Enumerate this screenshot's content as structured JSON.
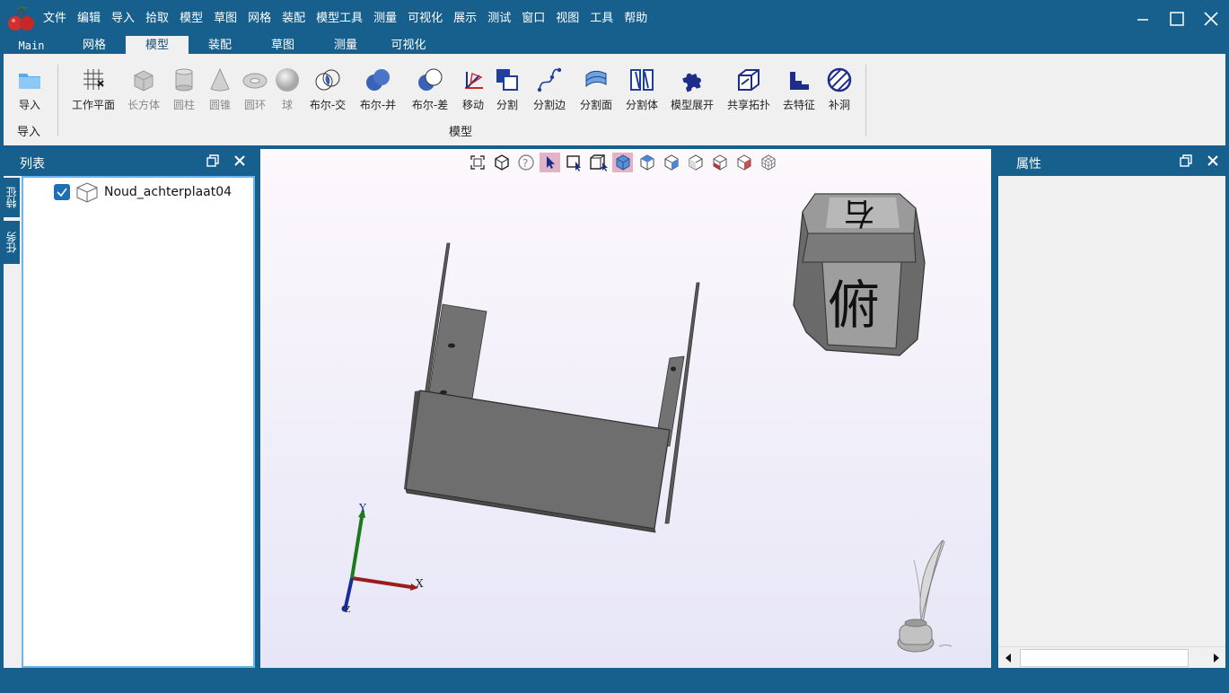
{
  "menu": [
    "文件",
    "编辑",
    "导入",
    "拾取",
    "模型",
    "草图",
    "网格",
    "装配",
    "模型工具",
    "测量",
    "可视化",
    "展示",
    "测试",
    "窗口",
    "视图",
    "工具",
    "帮助"
  ],
  "tabs": [
    "Main",
    "网格",
    "模型",
    "装配",
    "草图",
    "测量",
    "可视化"
  ],
  "active_tab": "模型",
  "ribbon": {
    "import_group": {
      "button": "导入",
      "label": "导入"
    },
    "model_group": {
      "label": "模型",
      "buttons": [
        "工作平面",
        "长方体",
        "圆柱",
        "圆锥",
        "圆环",
        "球",
        "布尔-交",
        "布尔-并",
        "布尔-差",
        "移动",
        "分割",
        "分割边",
        "分割面",
        "分割体",
        "模型展开",
        "共享拓扑",
        "去特征",
        "补洞"
      ]
    }
  },
  "left_panel": {
    "title": "列表",
    "vertical_tabs": [
      "特征",
      "任务"
    ],
    "tree": [
      {
        "label": "Noud_achterplaat04",
        "checked": true
      }
    ]
  },
  "right_panel": {
    "title": "属性"
  },
  "viewcube": {
    "top_face": "右",
    "front_face": "俯"
  },
  "axes": {
    "x": "X",
    "y": "Y",
    "z": "Z"
  },
  "colors": {
    "accent": "#175f8c",
    "ribbon_bg": "#f0f0f0",
    "selected_tool": "#e2b2c6"
  }
}
